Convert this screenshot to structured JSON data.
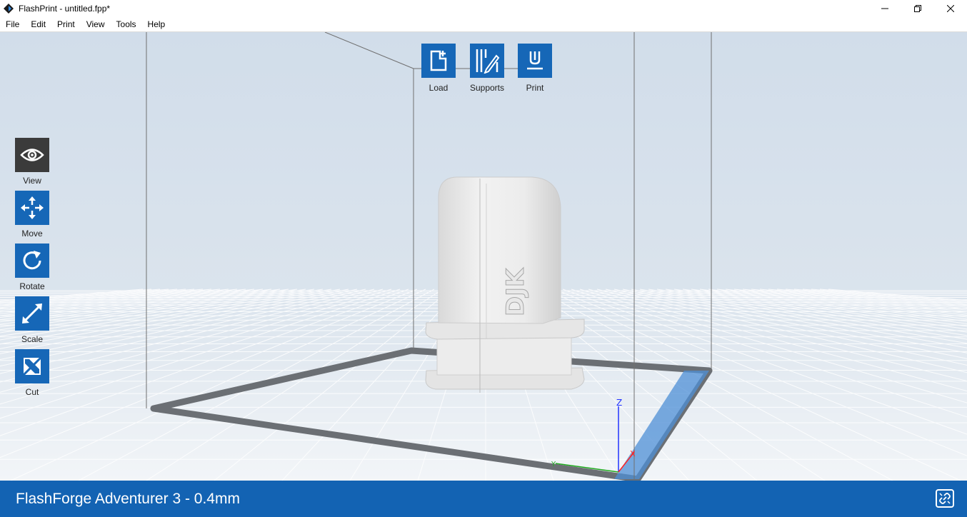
{
  "window": {
    "title": "FlashPrint - untitled.fpp*"
  },
  "menu": [
    "File",
    "Edit",
    "Print",
    "View",
    "Tools",
    "Help"
  ],
  "top_toolbar": [
    {
      "label": "Load",
      "icon": "load-icon"
    },
    {
      "label": "Supports",
      "icon": "supports-icon"
    },
    {
      "label": "Print",
      "icon": "print-icon"
    }
  ],
  "left_toolbar": [
    {
      "label": "View",
      "icon": "eye-icon",
      "active": true
    },
    {
      "label": "Move",
      "icon": "move-icon"
    },
    {
      "label": "Rotate",
      "icon": "rotate-icon"
    },
    {
      "label": "Scale",
      "icon": "scale-icon"
    },
    {
      "label": "Cut",
      "icon": "cut-icon"
    }
  ],
  "model": {
    "embossed_text": "DJK"
  },
  "axes": {
    "z_label": "Z",
    "x_label": "X",
    "y_label": "Y"
  },
  "status": {
    "printer": "FlashForge Adventurer 3 - 0.4mm",
    "icon": "link-icon"
  },
  "colors": {
    "accent": "#1667b7",
    "status_bar": "#1363b3",
    "viewport_bg": "#d3dfea",
    "active_tool": "#3b3b3b"
  }
}
